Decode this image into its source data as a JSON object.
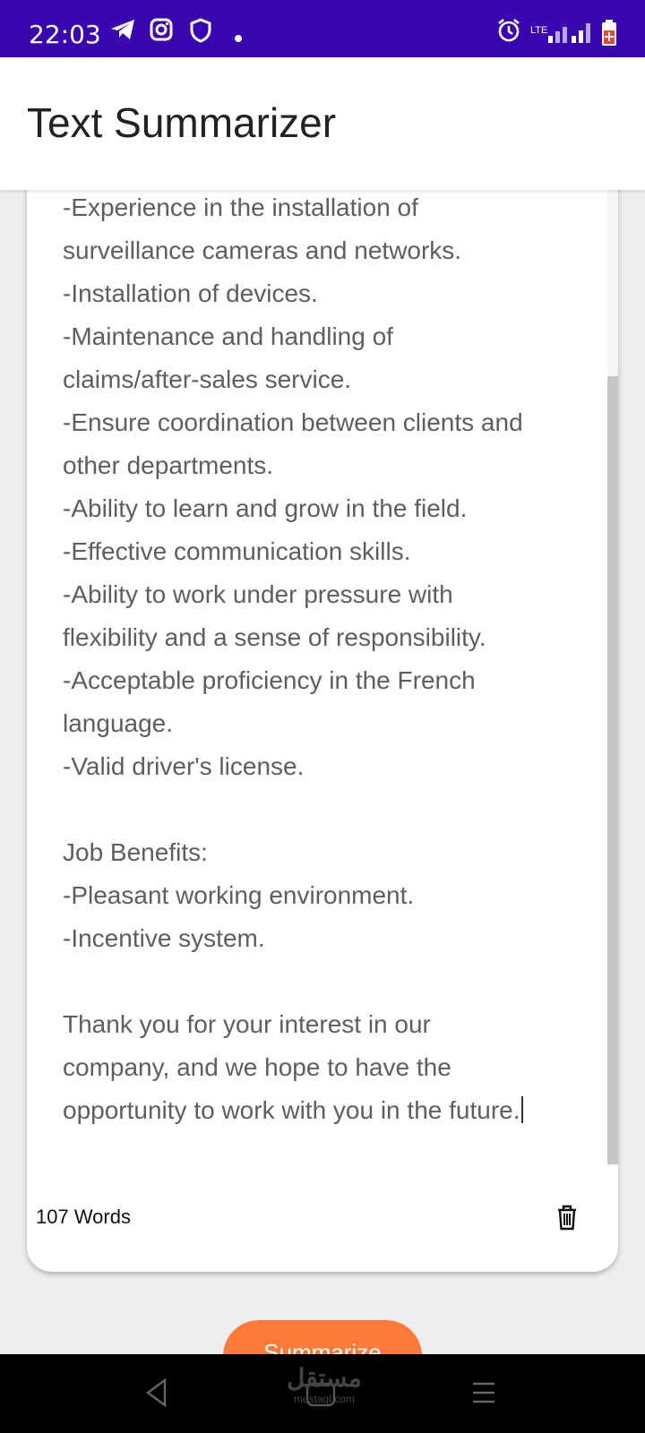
{
  "status": {
    "time": "22:03",
    "network": "LTE"
  },
  "app": {
    "title": "Text Summarizer"
  },
  "content": {
    "text": "-Experience in the installation of\nsurveillance cameras and networks.\n-Installation of devices.\n-Maintenance and handling of\nclaims/after-sales service.\n-Ensure coordination between clients and\nother departments.\n-Ability to learn and grow in the field.\n-Effective communication skills.\n-Ability to work under pressure with\nflexibility and a sense of responsibility.\n-Acceptable proficiency in the French\nlanguage.\n-Valid driver's license.\n\nJob Benefits:\n-Pleasant working environment.\n-Incentive system.\n\nThank you for your interest in our\ncompany, and we hope to have the\nopportunity to work with you in the future.",
    "word_count": "107 Words"
  },
  "actions": {
    "summarize_label": "Summarize"
  },
  "watermark": {
    "main": "مستقل",
    "sub": "mostaql.com"
  },
  "colors": {
    "status_bar": "#3a06b0",
    "accent": "#ff7a3a",
    "text": "#5e5e5e"
  },
  "icons": [
    "telegram-icon",
    "instagram-icon",
    "shield-icon",
    "alarm-icon",
    "signal-icon",
    "battery-icon",
    "trash-icon",
    "back-icon",
    "home-icon",
    "menu-icon"
  ]
}
